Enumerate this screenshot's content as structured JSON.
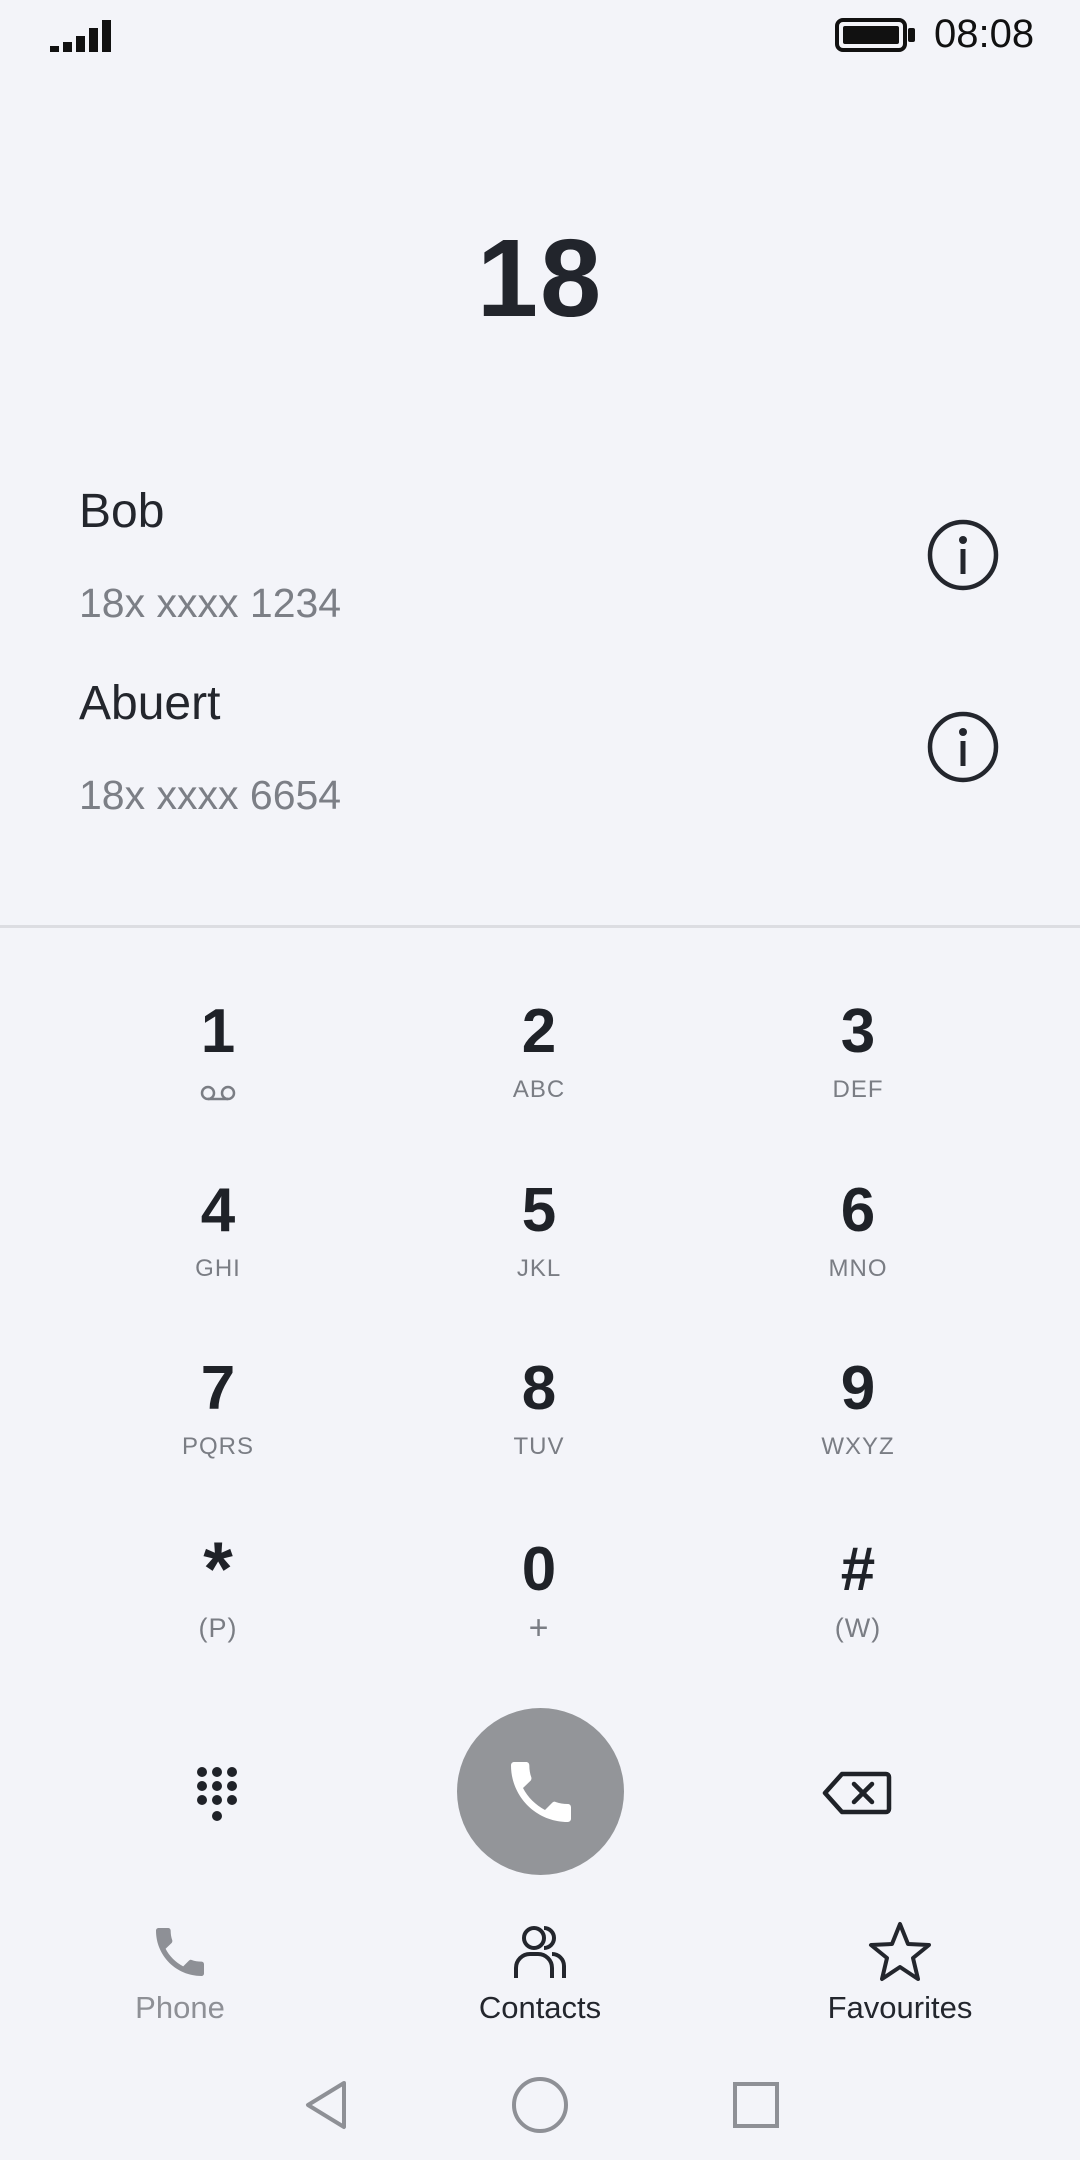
{
  "status_bar": {
    "time": "08:08",
    "signal_icon": "signal-bars-icon",
    "battery_icon": "battery-full-icon"
  },
  "dialer": {
    "dialed_number": "18"
  },
  "suggestions": [
    {
      "name": "Bob",
      "number": "18x xxxx 1234",
      "icon": "info-icon"
    },
    {
      "name": "Abuert",
      "number": "18x xxxx 6654",
      "icon": "info-icon"
    }
  ],
  "keypad": {
    "keys": [
      {
        "digit": "1",
        "letters": "",
        "icon": "voicemail-icon"
      },
      {
        "digit": "2",
        "letters": "ABC"
      },
      {
        "digit": "3",
        "letters": "DEF"
      },
      {
        "digit": "4",
        "letters": "GHI"
      },
      {
        "digit": "5",
        "letters": "JKL"
      },
      {
        "digit": "6",
        "letters": "MNO"
      },
      {
        "digit": "7",
        "letters": "PQRS"
      },
      {
        "digit": "8",
        "letters": "TUV"
      },
      {
        "digit": "9",
        "letters": "WXYZ"
      },
      {
        "digit": "*",
        "letters": "(P)"
      },
      {
        "digit": "0",
        "letters": "+"
      },
      {
        "digit": "#",
        "letters": "(W)"
      }
    ]
  },
  "actions": {
    "dialpad_icon": "dialpad-icon",
    "call_icon": "phone-call-icon",
    "backspace_icon": "backspace-icon",
    "call_button_color": "#939599"
  },
  "bottom_nav": {
    "tabs": [
      {
        "label": "Phone",
        "icon": "phone-icon",
        "active": false
      },
      {
        "label": "Contacts",
        "icon": "contacts-icon",
        "active": true
      },
      {
        "label": "Favourites",
        "icon": "star-icon",
        "active": true
      }
    ]
  },
  "system_nav": {
    "back_icon": "back-triangle-icon",
    "home_icon": "home-circle-icon",
    "recents_icon": "recents-square-icon"
  },
  "colors": {
    "background": "#f3f4f9",
    "primary_text": "#23262d",
    "secondary_text": "#7c7f86"
  }
}
